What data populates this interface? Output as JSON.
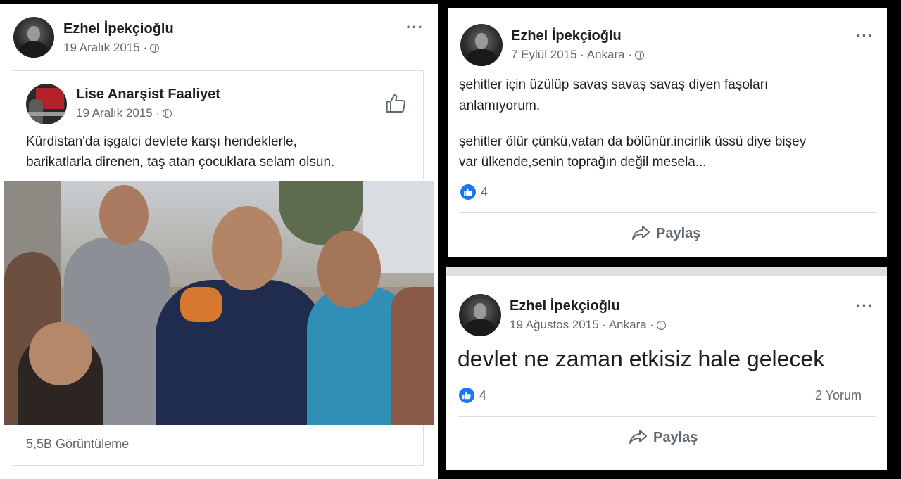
{
  "post1": {
    "author": "Ezhel İpekçioğlu",
    "date": "19 Aralık 2015 ·",
    "more_icon": "more-dots-icon",
    "shared": {
      "page_name": "Lise Anarşist Faaliyet",
      "date": "19 Aralık 2015 ·",
      "text_line1": "Kürdistan'da işgalci devlete karşı hendeklerle,",
      "text_line2": "barikatlarla direnen, taş atan çocuklara selam olsun.",
      "like_icon": "thumbs-up-icon"
    },
    "views": "5,5B Görüntüleme"
  },
  "post2": {
    "author": "Ezhel İpekçioğlu",
    "date": "7 Eylül 2015 · Ankara ·",
    "text_line1": "şehitler için üzülüp savaş savaş savaş diyen faşoları",
    "text_line2": "anlamıyorum.",
    "text_line3": "şehitler ölür çünkü,vatan da bölünür.incirlik üssü diye bişey",
    "text_line4": "var ülkende,senin toprağın değil mesela...",
    "like_count": "4",
    "share_label": "Paylaş"
  },
  "post3": {
    "author": "Ezhel İpekçioğlu",
    "date": "19 Ağustos 2015 · Ankara ·",
    "text": "devlet ne zaman etkisiz hale gelecek",
    "like_count": "4",
    "comments": "2 Yorum",
    "share_label": "Paylaş"
  },
  "colors": {
    "accent": "#1877f2",
    "muted_text": "#65676b",
    "background": "#000000"
  }
}
